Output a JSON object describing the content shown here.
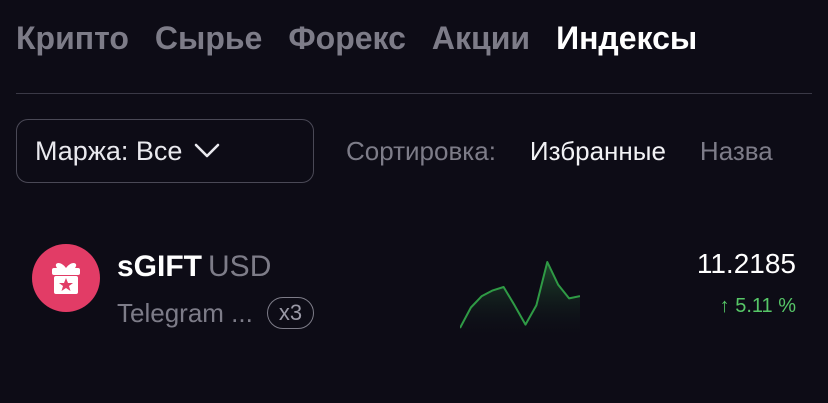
{
  "tabs": [
    {
      "label": "Крипто",
      "active": false
    },
    {
      "label": "Сырье",
      "active": false
    },
    {
      "label": "Форекс",
      "active": false
    },
    {
      "label": "Акции",
      "active": false
    },
    {
      "label": "Индексы",
      "active": true
    }
  ],
  "filter": {
    "margin_label": "Маржа: Все",
    "sort_label": "Сортировка:",
    "sort_options": [
      "Избранные",
      "Назва"
    ]
  },
  "asset": {
    "icon": "gift-icon",
    "symbol": "sGIFT",
    "quote": "USD",
    "name": "Telegram ...",
    "leverage": "x3",
    "price": "11.2185",
    "change_arrow": "↑",
    "change": "5.11 %",
    "sparkline": [
      58,
      40,
      30,
      25,
      22,
      38,
      55,
      38,
      0,
      20,
      32,
      30
    ]
  },
  "colors": {
    "background": "#0d0c16",
    "accent_green": "#56c667",
    "avatar_bg": "#e23c66"
  }
}
